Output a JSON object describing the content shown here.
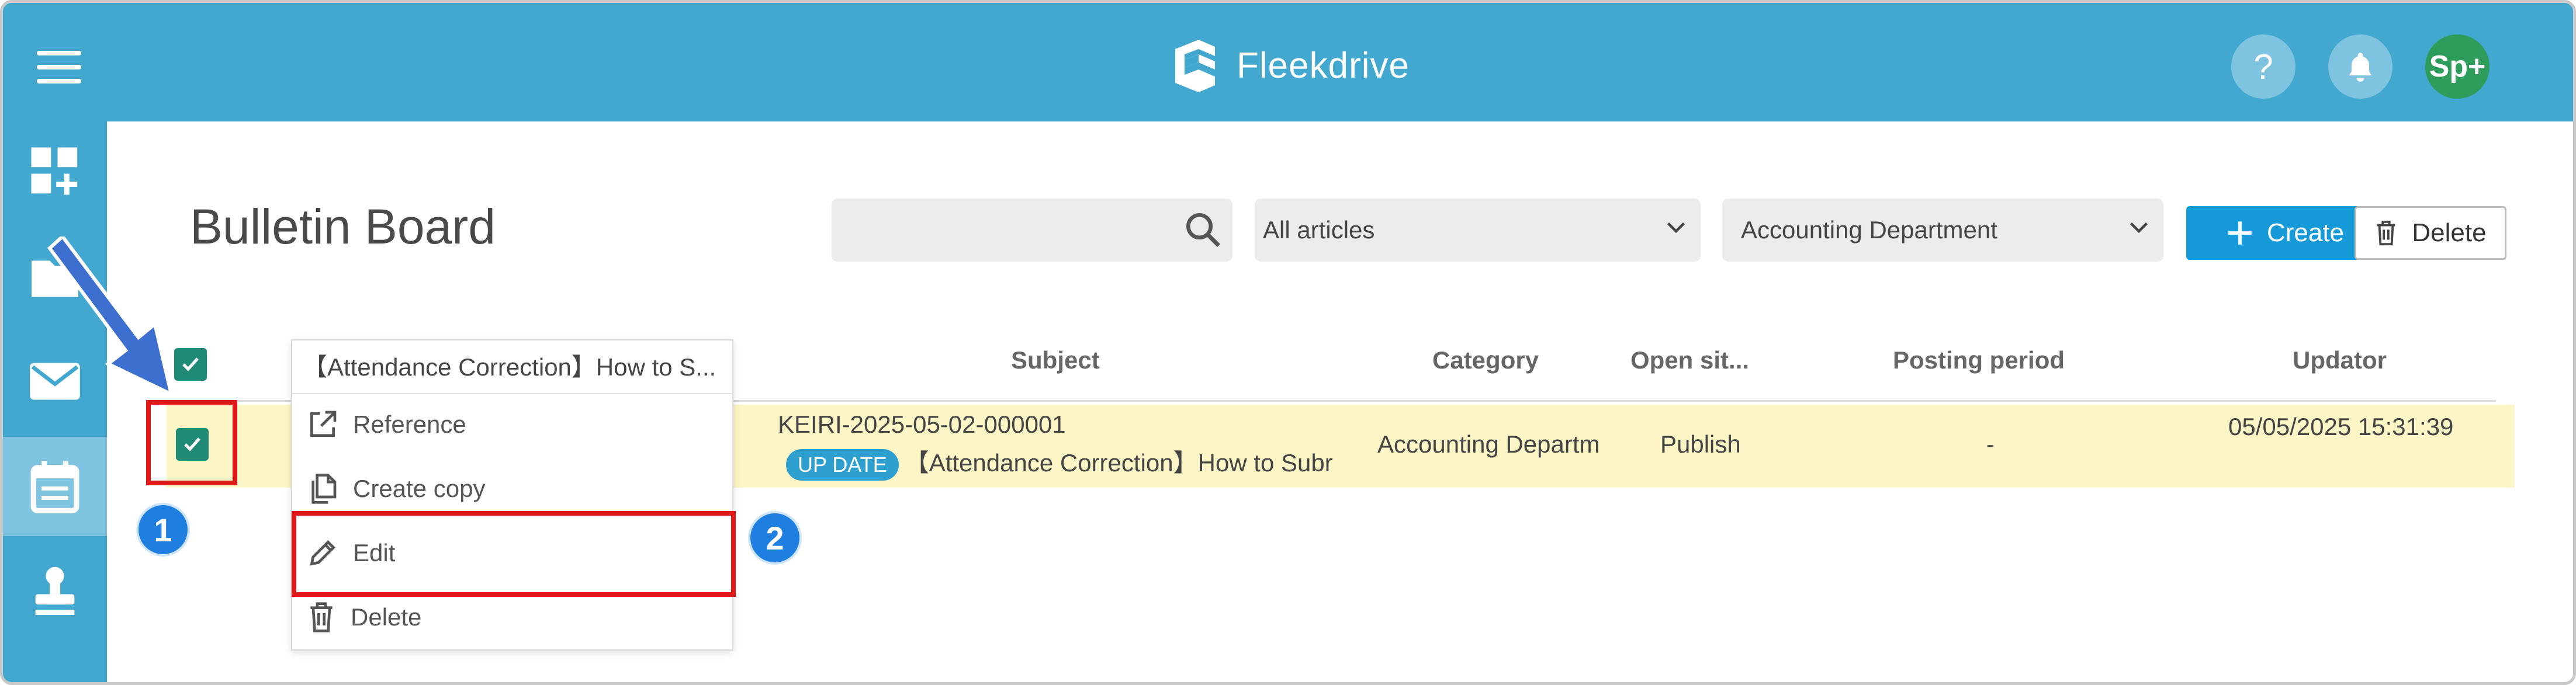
{
  "header": {
    "app_name": "Fleekdrive",
    "help_label": "?",
    "user_initials": "Sp+"
  },
  "sidebar": {
    "items": [
      {
        "icon": "dashboard-add-icon"
      },
      {
        "icon": "folder-icon"
      },
      {
        "icon": "mail-icon"
      },
      {
        "icon": "calendar-icon",
        "active": true
      },
      {
        "icon": "stamp-icon"
      }
    ]
  },
  "page": {
    "title": "Bulletin Board"
  },
  "toolbar": {
    "search_placeholder": "",
    "filter_articles": "All articles",
    "filter_department": "Accounting Department",
    "create_label": "Create",
    "delete_label": "Delete"
  },
  "table": {
    "headers": {
      "subject": "Subject",
      "category": "Category",
      "open_site": "Open sit...",
      "posting_period": "Posting period",
      "updator": "Updator"
    },
    "rows": [
      {
        "id": "KEIRI-2025-05-02-000001",
        "badge": "UP DATE",
        "subject": "【Attendance Correction】How to Subr",
        "category": "Accounting Departm",
        "open_site": "Publish",
        "posting_period": "-",
        "updated": "05/05/2025 15:31:39"
      }
    ]
  },
  "context_menu": {
    "title": "【Attendance Correction】How to S...",
    "items": [
      {
        "label": "Reference",
        "icon": "external-link-icon"
      },
      {
        "label": "Create copy",
        "icon": "copy-icon"
      },
      {
        "label": "Edit",
        "icon": "pencil-icon"
      },
      {
        "label": "Delete",
        "icon": "trash-icon"
      }
    ]
  },
  "annotations": {
    "step1": "1",
    "step2": "2"
  },
  "colors": {
    "header_bg": "#42a8d0",
    "row_highlight": "#fcf5c5",
    "checkbox": "#1f8a76",
    "create_button": "#179bd8",
    "annotation_red": "#e01818",
    "annotation_blue": "#1e7fe0"
  }
}
